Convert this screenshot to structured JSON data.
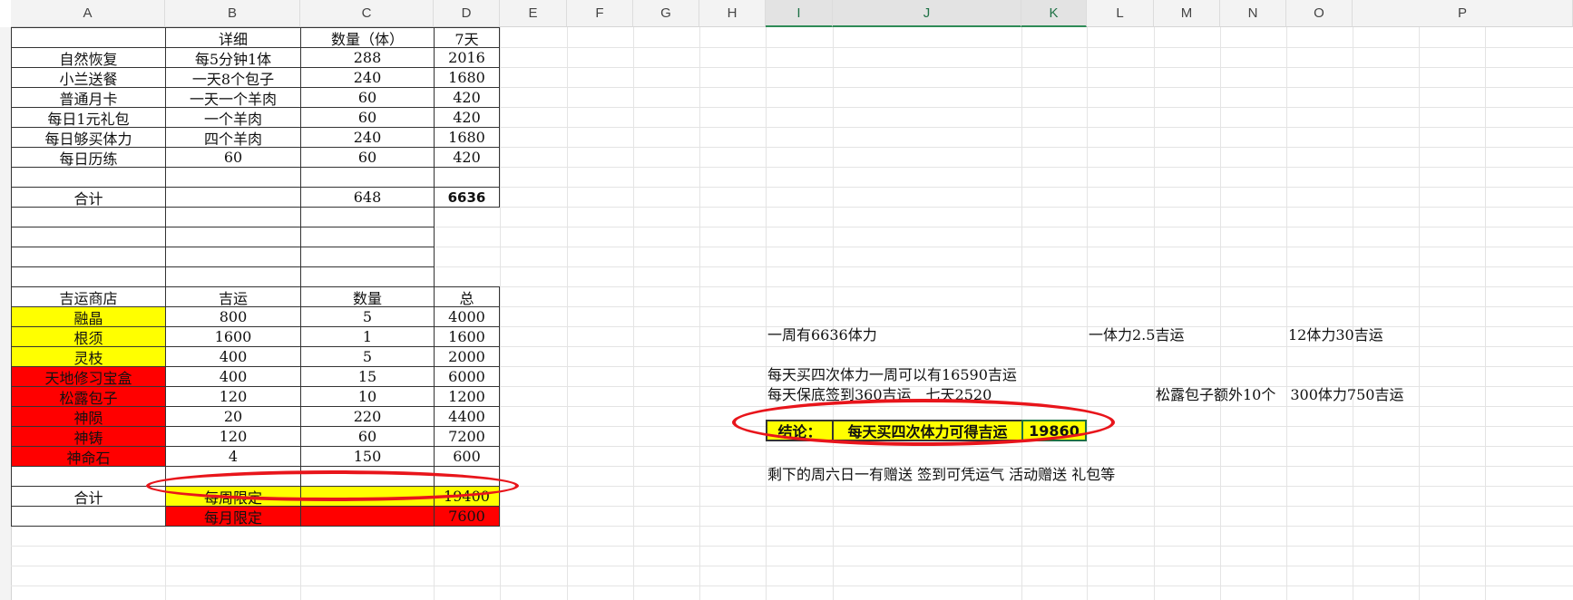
{
  "columns": [
    "A",
    "B",
    "C",
    "D",
    "E",
    "F",
    "G",
    "H",
    "I",
    "J",
    "K",
    "L",
    "M",
    "N",
    "O",
    "P"
  ],
  "table1": {
    "headers": [
      "",
      "详细",
      "数量（体）",
      "7天"
    ],
    "rows": [
      [
        "自然恢复",
        "每5分钟1体",
        "288",
        "2016"
      ],
      [
        "小兰送餐",
        "一天8个包子",
        "240",
        "1680"
      ],
      [
        "普通月卡",
        "一天一个羊肉",
        "60",
        "420"
      ],
      [
        "每日1元礼包",
        "一个羊肉",
        "60",
        "420"
      ],
      [
        "每日够买体力",
        "四个羊肉",
        "240",
        "1680"
      ],
      [
        "每日历练",
        "60",
        "60",
        "420"
      ]
    ],
    "total_label": "合计",
    "total_qty": "648",
    "total_7d": "6636"
  },
  "table2": {
    "headers": [
      "吉运商店",
      "吉运",
      "数量",
      "总"
    ],
    "rows": [
      {
        "cells": [
          "融晶",
          "800",
          "5",
          "4000"
        ],
        "color": "yellow"
      },
      {
        "cells": [
          "根须",
          "1600",
          "1",
          "1600"
        ],
        "color": "yellow"
      },
      {
        "cells": [
          "灵枝",
          "400",
          "5",
          "2000"
        ],
        "color": "yellow"
      },
      {
        "cells": [
          "天地修习宝盒",
          "400",
          "15",
          "6000"
        ],
        "color": "red"
      },
      {
        "cells": [
          "松露包子",
          "120",
          "10",
          "1200"
        ],
        "color": "red"
      },
      {
        "cells": [
          "神陨",
          "20",
          "220",
          "4400"
        ],
        "color": "red"
      },
      {
        "cells": [
          "神铸",
          "120",
          "60",
          "7200"
        ],
        "color": "red"
      },
      {
        "cells": [
          "神命石",
          "4",
          "150",
          "600"
        ],
        "color": "red"
      }
    ],
    "total_label": "合计",
    "weekly_label": "每周限定",
    "weekly_total": "19400",
    "monthly_label": "每月限定",
    "monthly_total": "7600"
  },
  "notes": {
    "week_stamina": "一周有6636体力",
    "ratio1": "一体力2.5吉运",
    "ratio2": "12体力30吉运",
    "buy4": "每天买四次体力一周可以有16590吉运",
    "signin": "每天保底签到360吉运　七天2520",
    "bun": "松露包子额外10个　300体力750吉运",
    "remaining": "剩下的周六日一有赠送 签到可凭运气 活动赠送 礼包等"
  },
  "conclusion": {
    "label": "结论：",
    "text": "每天买四次体力可得吉运",
    "value": "19860"
  },
  "colors": {
    "yellow": "#ffff00",
    "red": "#ff0000",
    "oval": "#e8151b",
    "accent": "#1e7145"
  }
}
